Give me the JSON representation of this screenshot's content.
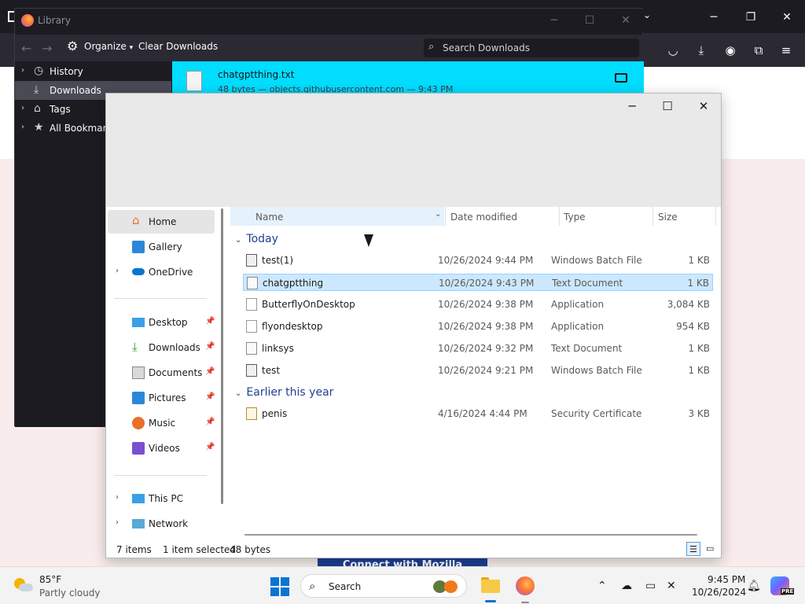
{
  "firefox": {
    "banner_text": "Connect with Mozilla"
  },
  "library": {
    "title": "Library",
    "toolbar": {
      "organize_label": "Organize",
      "clear_downloads_label": "Clear Downloads",
      "search_placeholder": "Search Downloads"
    },
    "tree": [
      {
        "label": "History",
        "icon": "clock-icon"
      },
      {
        "label": "Downloads",
        "icon": "download-icon",
        "selected": true
      },
      {
        "label": "Tags",
        "icon": "tag-icon"
      },
      {
        "label": "All Bookmarks",
        "icon": "star-icon"
      }
    ],
    "download_item": {
      "file_name": "chatgptthing.txt",
      "meta": "48 bytes — objects.githubusercontent.com — 9:43 PM"
    }
  },
  "explorer": {
    "nav": {
      "home": "Home",
      "gallery": "Gallery",
      "onedrive": "OneDrive",
      "desktop": "Desktop",
      "downloads": "Downloads",
      "documents": "Documents",
      "pictures": "Pictures",
      "music": "Music",
      "videos": "Videos",
      "this_pc": "This PC",
      "network": "Network"
    },
    "columns": {
      "name": "Name",
      "date_modified": "Date modified",
      "type": "Type",
      "size": "Size"
    },
    "groups": {
      "today": "Today",
      "earlier": "Earlier this year"
    },
    "files_today": [
      {
        "name": "test(1)",
        "date": "10/26/2024 9:44 PM",
        "type": "Windows Batch File",
        "size": "1 KB",
        "icon": "batch-file-icon"
      },
      {
        "name": "chatgptthing",
        "date": "10/26/2024 9:43 PM",
        "type": "Text Document",
        "size": "1 KB",
        "icon": "text-file-icon",
        "selected": true
      },
      {
        "name": "ButterflyOnDesktop",
        "date": "10/26/2024 9:38 PM",
        "type": "Application",
        "size": "3,084 KB",
        "icon": "application-icon"
      },
      {
        "name": "flyondesktop",
        "date": "10/26/2024 9:38 PM",
        "type": "Application",
        "size": "954 KB",
        "icon": "application-icon"
      },
      {
        "name": "linksys",
        "date": "10/26/2024 9:32 PM",
        "type": "Text Document",
        "size": "1 KB",
        "icon": "text-file-icon"
      },
      {
        "name": "test",
        "date": "10/26/2024 9:21 PM",
        "type": "Windows Batch File",
        "size": "1 KB",
        "icon": "batch-file-icon"
      }
    ],
    "files_earlier": [
      {
        "name": "penis",
        "date": "4/16/2024 4:44 PM",
        "type": "Security Certificate",
        "size": "3 KB",
        "icon": "certificate-icon"
      }
    ],
    "status": {
      "item_count": "7 items",
      "selection": "1 item selected",
      "selection_size": "48 bytes"
    }
  },
  "taskbar": {
    "weather_temp": "85°F",
    "weather_condition": "Partly cloudy",
    "search_label": "Search",
    "time": "9:45 PM",
    "date": "10/26/2024",
    "copilot_badge": "PRE"
  }
}
